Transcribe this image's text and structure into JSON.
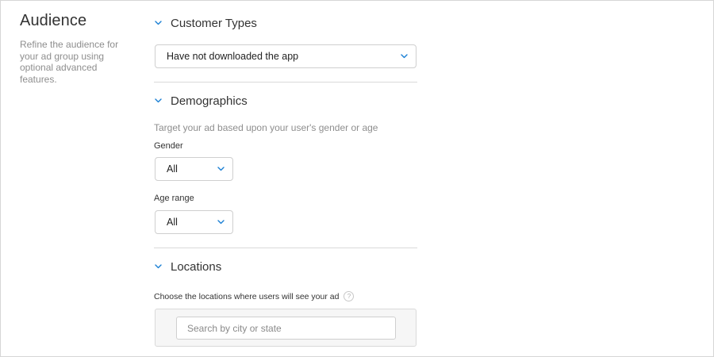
{
  "section": {
    "title": "Audience",
    "description": "Refine the audience for your ad group using optional advanced features."
  },
  "customer_types": {
    "title": "Customer Types",
    "selected": "Have not downloaded the app"
  },
  "demographics": {
    "title": "Demographics",
    "helper": "Target your ad based upon your user's gender or age",
    "gender_label": "Gender",
    "gender_value": "All",
    "age_label": "Age range",
    "age_value": "All"
  },
  "locations": {
    "title": "Locations",
    "label": "Choose the locations where users will see your ad",
    "help_glyph": "?",
    "search_placeholder": "Search by city or state",
    "search_value": ""
  },
  "colors": {
    "accent": "#1a7fd4",
    "divider": "#d9d9d9",
    "muted_text": "#8e8e8e"
  },
  "icons": {
    "section_toggle": "chevron-down-icon",
    "select_caret": "chevron-down-icon",
    "help": "question-circle-icon"
  }
}
